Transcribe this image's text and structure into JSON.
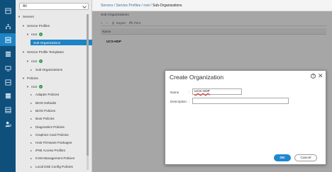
{
  "rail": {
    "items": [
      {
        "icon": "dashboard-icon"
      },
      {
        "icon": "equipment-icon"
      },
      {
        "icon": "servers-icon",
        "active": true
      },
      {
        "icon": "lan-icon"
      },
      {
        "icon": "san-icon"
      },
      {
        "icon": "vm-icon"
      },
      {
        "icon": "storage-icon"
      },
      {
        "icon": "chassis-icon"
      },
      {
        "icon": "admin-icon"
      }
    ]
  },
  "filter": {
    "value": "All"
  },
  "tree": {
    "servers": "Servers",
    "service_profiles": "Service Profiles",
    "root1": "root",
    "sub_orgs1": "Sub-Organizations",
    "service_profile_templates": "Service Profile Templates",
    "root2": "root",
    "sub_orgs2": "Sub-Organizations",
    "policies": "Policies",
    "root3": "root",
    "policy_items": [
      "Adapter Policies",
      "BIOS Defaults",
      "BIOS Policies",
      "Boot Policies",
      "Diagnostics Policies",
      "Graphics Card Policies",
      "Host Firmware Packages",
      "IPMI Access Profiles",
      "KVM Management Policies",
      "Local Disk Config Policies"
    ]
  },
  "breadcrumb": {
    "servers": "Servers",
    "service_profiles": "Service Profiles",
    "root": "root",
    "current": "Sub-Organizations",
    "separator": "/"
  },
  "main": {
    "title": "Sub-Organizations",
    "toolbar": {
      "add": "+",
      "remove": "−",
      "export_label": "Export",
      "print_label": "Print"
    },
    "column_name": "Name",
    "rows": [
      "UCS-HDP"
    ]
  },
  "dialog": {
    "title": "Create Organization",
    "help": "?",
    "close": "✕",
    "name_label": "Name",
    "name_value": "UCS-HDP",
    "description_label": "Description",
    "description_value": "",
    "colon": ":",
    "ok_label": "OK",
    "cancel_label": "Cancel"
  },
  "colors": {
    "rail": "#0f4f7c",
    "accent": "#1d83c4",
    "ok_button": "#1e88d1",
    "add_green": "#2f9b46"
  }
}
